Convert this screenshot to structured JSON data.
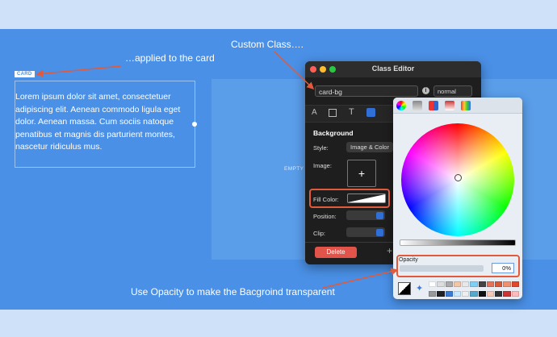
{
  "annotations": {
    "custom_class": "Custom Class….",
    "applied": "…applied to the card",
    "opacity_tip": "Use Opacity to make the Bacgroind transparent"
  },
  "card": {
    "tag": "CARD",
    "text": "Lorem ipsum dolor sit amet, consectetuer adipiscing elit. Aenean commodo ligula eget dolor. Aenean massa. Cum sociis natoque penatibus et magnis dis parturient montes, nascetur ridiculus mus."
  },
  "empty_label": "EMPTY",
  "class_editor": {
    "title": "Class Editor",
    "class_name": "card-bg",
    "state": "normal",
    "section": "Background",
    "style_label": "Style:",
    "style_value": "Image & Color",
    "image_label": "Image:",
    "fill_label": "Fill Color:",
    "position_label": "Position:",
    "clip_label": "Clip:",
    "delete_label": "Delete",
    "add_symbol": "+"
  },
  "color_picker": {
    "opacity_label": "Opacity",
    "opacity_value": "0%"
  },
  "colors": {
    "band": "#4a90e6",
    "accent": "#e05a3b",
    "delete": "#e2544a"
  }
}
